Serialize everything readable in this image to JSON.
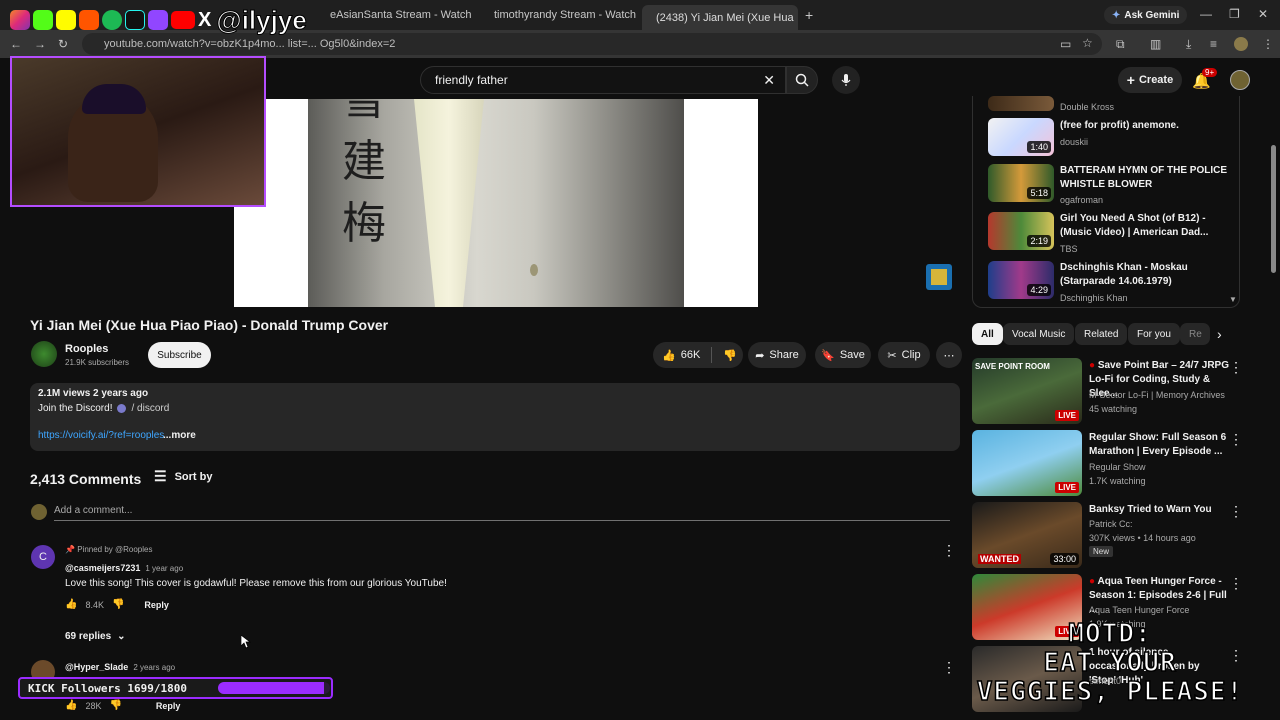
{
  "browser": {
    "tabs": [
      {
        "label": "eAsianSanta Stream - Watch",
        "favicon": "kick-icon"
      },
      {
        "label": "timothyrandy Stream - Watch L",
        "favicon": "kick-icon"
      },
      {
        "label": "(2438) Yi Jian Mei (Xue Hua",
        "favicon": "youtube-icon",
        "active": true
      }
    ],
    "ask_gemini": "Ask Gemini",
    "url": "youtube.com/watch?v=obzK1p4mo... list=... Og5l0&index=2"
  },
  "overlay": {
    "streamer_handle": "@ilyjye",
    "kick_followers_label": "KICK Followers 1699/1800",
    "kick_followers_progress": 0.9439,
    "motd": "MOTD:\nEAT YOUR\nVEGGIES, PLEASE!"
  },
  "header": {
    "search_value": "friendly father",
    "create_label": "Create",
    "notif_badge": "9+"
  },
  "video": {
    "overlay_chars": [
      "雪",
      "建",
      "梅"
    ],
    "title": "Yi Jian Mei (Xue Hua Piao Piao) - Donald Trump Cover",
    "channel": "Rooples",
    "subscribers": "21.9K subscribers",
    "subscribe_label": "Subscribe",
    "likes": "66K",
    "share_label": "Share",
    "save_label": "Save",
    "clip_label": "Clip"
  },
  "description": {
    "stats": "2.1M views  2 years ago",
    "line1": "Join the Discord!",
    "discord_link": "/ discord",
    "link": "https://voicify.ai/?ref=rooples",
    "more_label": "...more"
  },
  "comments": {
    "count": "2,413 Comments",
    "sort_label": "Sort by",
    "add_placeholder": "Add a comment...",
    "items": [
      {
        "pinned": "Pinned by @Rooples",
        "handle": "@casmeijers7231",
        "time": "1 year ago",
        "text": "Love this song! This cover is godawful! Please remove this from our glorious YouTube!",
        "likes": "8.4K",
        "reply_label": "Reply",
        "replies_label": "69 replies",
        "avatar_letter": "C"
      },
      {
        "handle": "@Hyper_Slade",
        "time": "2 years ago",
        "likes": "28K",
        "reply_label": "Reply"
      }
    ]
  },
  "sidebar": {
    "top_list": [
      {
        "title": "",
        "channel": "Double Kross",
        "duration": ""
      },
      {
        "title": "(free for profit) anemone.",
        "channel": "douskii",
        "duration": "1:40"
      },
      {
        "title": "BATTERAM HYMN OF THE POLICE WHISTLE BLOWER",
        "channel": "ogafroman",
        "duration": "5:18"
      },
      {
        "title": "Girl You Need A Shot (of B12) - (Music Video) | American Dad...",
        "channel": "TBS",
        "duration": "2:19"
      },
      {
        "title": "Dschinghis Khan - Moskau (Starparade 14.06.1979)",
        "channel": "Dschinghis Khan",
        "duration": "4:29"
      }
    ],
    "chips": [
      "All",
      "Vocal Music",
      "Related",
      "For you",
      "Re"
    ],
    "recs": [
      {
        "title": "Save Point Bar – 24/7 JRPG Lo-Fi for Coding, Study & Slee...",
        "channel": "M-Sector Lo-Fi | Memory Archives",
        "meta": "45 watching",
        "badge": "LIVE",
        "thumb_text": "SAVE POINT ROOM"
      },
      {
        "title": "Regular Show: Full Season 6 Marathon | Every Episode ...",
        "channel": "Regular Show",
        "meta": "1.7K watching",
        "badge": "LIVE"
      },
      {
        "title": "Banksy Tried to Warn You",
        "channel": "Patrick Cc:",
        "meta": "307K views • 14 hours ago",
        "new": "New",
        "badge": "33:00",
        "thumb_text": "WANTED"
      },
      {
        "title": "Aqua Teen Hunger Force - Season 1: Episodes 2-6 | Full ...",
        "channel": "Aqua Teen Hunger Force",
        "meta": "1.9K watching",
        "badge": "LIVE"
      },
      {
        "title": "1 hour of silence occasionally broken by 'Stop' 'Huh'",
        "channel": "piment0",
        "meta": "",
        "badge": ""
      }
    ]
  },
  "colors": {
    "bg": "#0f0f0f",
    "surface": "#272727",
    "accent_red": "#cc0000",
    "kick_purple": "#9b2cff",
    "text_secondary": "#aaaaaa"
  }
}
